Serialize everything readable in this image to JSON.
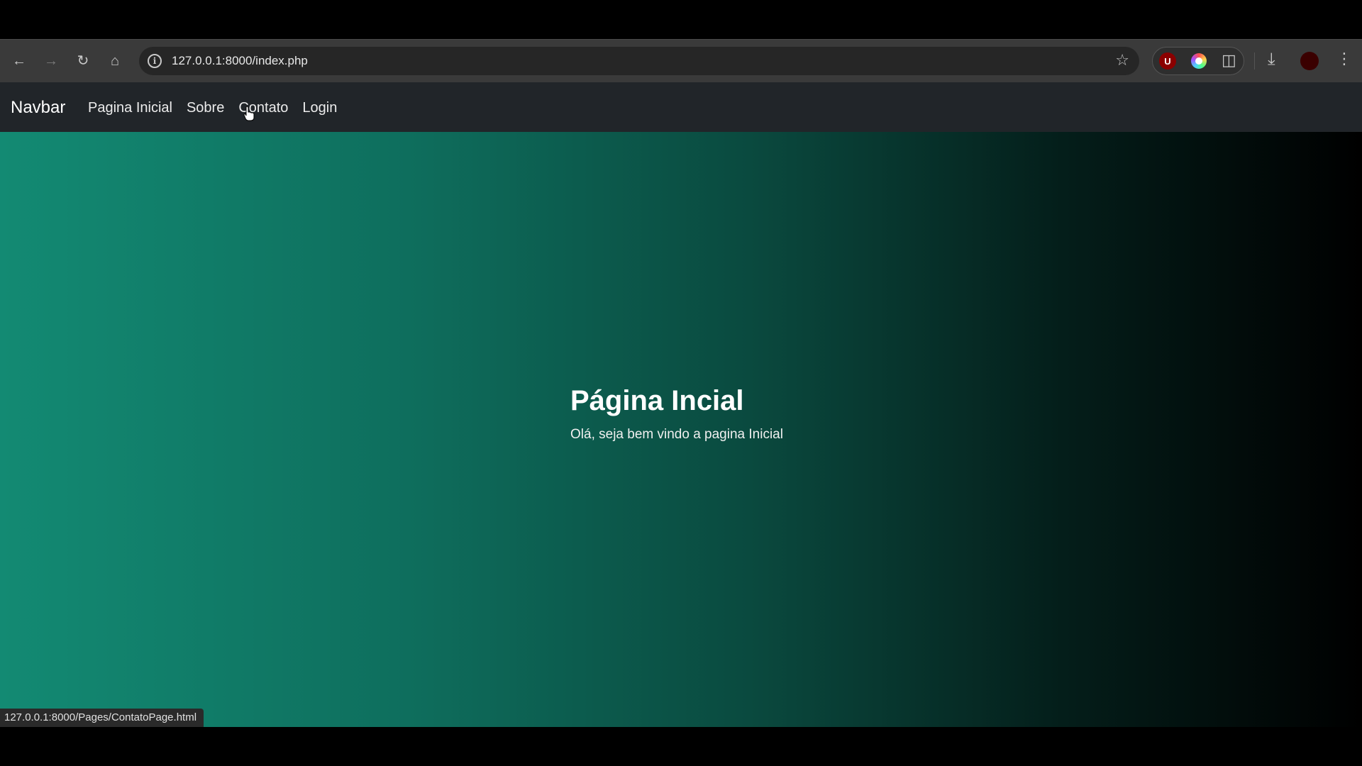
{
  "browser": {
    "url": "127.0.0.1:8000/index.php",
    "status_url": "127.0.0.1:8000/Pages/ContatoPage.html",
    "icons": {
      "back": "back-arrow-icon",
      "forward": "forward-arrow-icon",
      "reload": "reload-icon",
      "home": "home-icon",
      "info": "site-info-icon",
      "bookmark": "star-icon",
      "ublock": "ublock-icon",
      "color_ext": "color-picker-icon",
      "extensions": "puzzle-icon",
      "downloads": "download-icon",
      "menu": "kebab-menu-icon"
    },
    "ublock_letter": "U"
  },
  "site": {
    "brand": "Navbar",
    "nav": [
      {
        "label": "Pagina Inicial"
      },
      {
        "label": "Sobre"
      },
      {
        "label": "Contato"
      },
      {
        "label": "Login"
      }
    ],
    "hero": {
      "title": "Página Incial",
      "subtitle": "Olá, seja bem vindo a pagina Inicial"
    },
    "colors": {
      "nav_bg": "#212529",
      "gradient_start": "#138a73",
      "gradient_end": "#000000"
    }
  }
}
